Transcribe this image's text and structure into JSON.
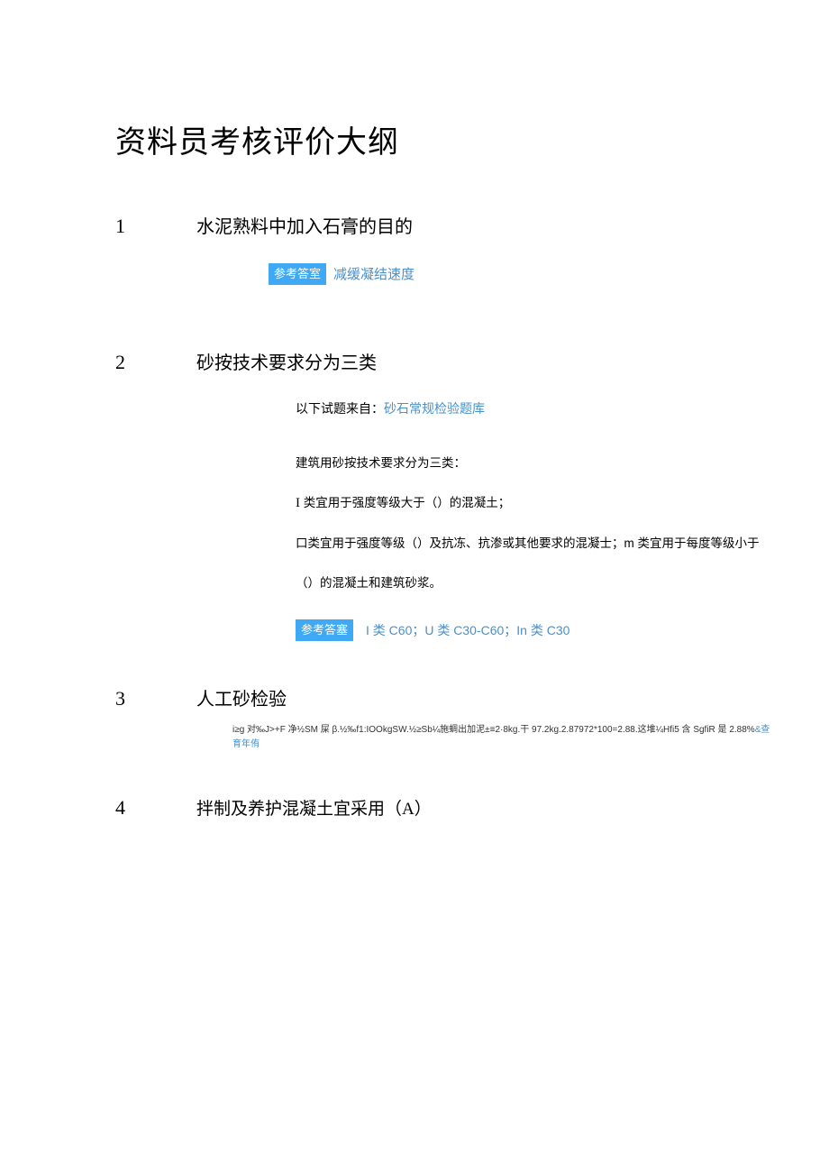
{
  "title": "资料员考核评价大纲",
  "sections": [
    {
      "num": "1",
      "heading": "水泥熟料中加入石膏的目的",
      "answer_badge": "参考答室",
      "answer_text": "减缓凝结速度"
    },
    {
      "num": "2",
      "heading": "砂按技术要求分为三类",
      "source_prefix": "以下试题来自：",
      "source_link": "砂石常规检验题库",
      "body_lines": [
        "建筑用砂按技术要求分为三类：",
        "I 类宜用于强度等级大于（）的混凝土；",
        "口类宜用于强度等级（）及抗冻、抗渗或其他要求的混凝士；m 类宜用于每度等级小于",
        "（）的混凝土和建筑砂浆。"
      ],
      "answer_badge": "参考答塞",
      "answer_text": "I 类 C60；U 类 C30-C60；In 类 C30"
    },
    {
      "num": "3",
      "heading": "人工砂检验",
      "garble_black": "i≥g 对‰J>+F 净½SM 屎 β.½‰f1:IOOkgSW.½≥Sb¼施蜩出加泥±≡2·8kg.干 97.2kg.2.87972*100=2.88.这堆¼Hfi5 含 SgfiR 是 2.88%",
      "garble_blue": "&查育年侑"
    },
    {
      "num": "4",
      "heading": "拌制及养护混凝土宜采用（A）"
    }
  ]
}
